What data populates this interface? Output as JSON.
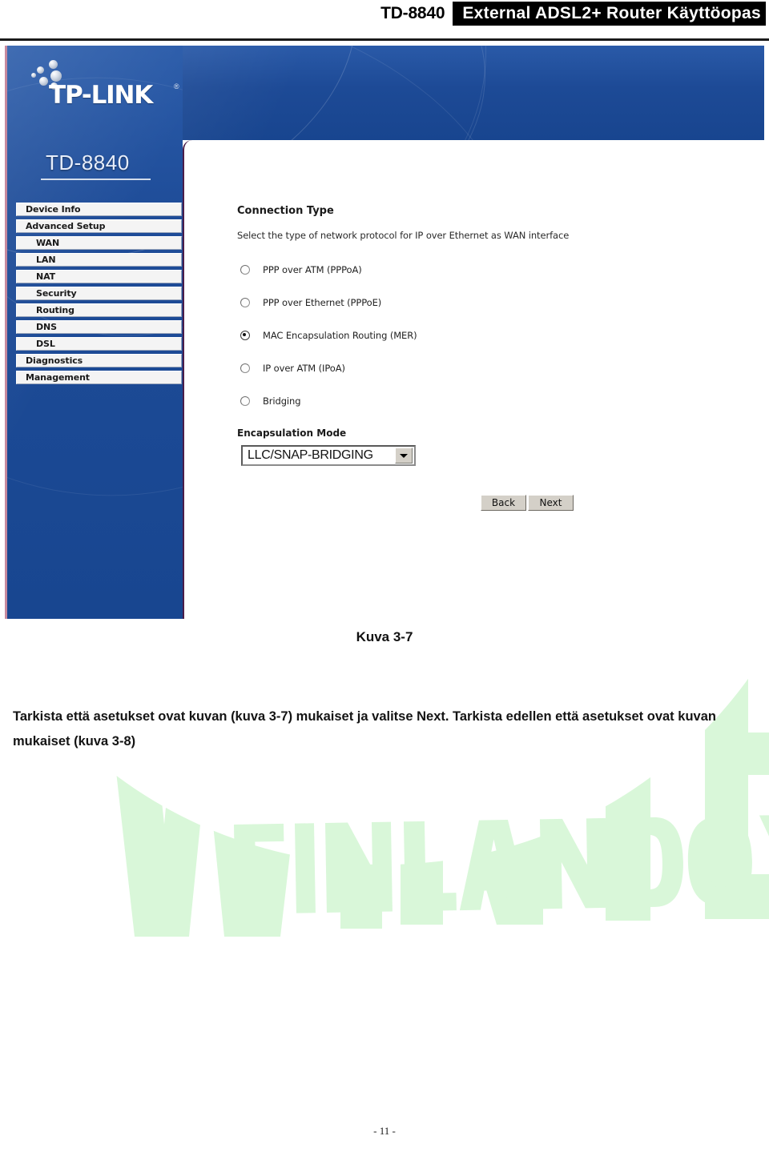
{
  "header": {
    "model": "TD-8840",
    "title": "External  ADSL2+  Router  Käyttöopas"
  },
  "screenshot": {
    "brand": "TP-LINK",
    "brand_reg": "®",
    "device_model": "TD-8840",
    "sidebar": {
      "items": [
        {
          "label": "Device Info",
          "level": 0
        },
        {
          "label": "Advanced Setup",
          "level": 0
        },
        {
          "label": "WAN",
          "level": 1
        },
        {
          "label": "LAN",
          "level": 1
        },
        {
          "label": "NAT",
          "level": 1
        },
        {
          "label": "Security",
          "level": 1
        },
        {
          "label": "Routing",
          "level": 1
        },
        {
          "label": "DNS",
          "level": 1
        },
        {
          "label": "DSL",
          "level": 1
        },
        {
          "label": "Diagnostics",
          "level": 0
        },
        {
          "label": "Management",
          "level": 0
        }
      ]
    },
    "panel": {
      "title": "Connection Type",
      "description": "Select the type of network protocol for IP over Ethernet as WAN interface",
      "connection_types": [
        {
          "label": "PPP over ATM (PPPoA)",
          "selected": false
        },
        {
          "label": "PPP over Ethernet (PPPoE)",
          "selected": false
        },
        {
          "label": "MAC Encapsulation Routing (MER)",
          "selected": true
        },
        {
          "label": "IP over ATM (IPoA)",
          "selected": false
        },
        {
          "label": "Bridging",
          "selected": false
        }
      ],
      "encapsulation": {
        "title": "Encapsulation Mode",
        "value": "LLC/SNAP-BRIDGING"
      },
      "buttons": {
        "back": "Back",
        "next": "Next"
      }
    },
    "colors": {
      "banner_blue": "#1d4a96",
      "sidebar_border_pink": "#c78a9e",
      "panel_border_purple": "#4b1d49"
    }
  },
  "figure_caption": "Kuva 3-7",
  "body_text": "Tarkista että asetukset ovat kuvan (kuva 3-7) mukaiset ja valitse Next.   Tarkista edellen että asetukset ovat kuvan mukaiset (kuva 3-8)",
  "watermark": {
    "line1": "WINTEL",
    "line2": "FINLAND OY",
    "color": "#d9f7d9"
  },
  "page_number": "- 11 -"
}
